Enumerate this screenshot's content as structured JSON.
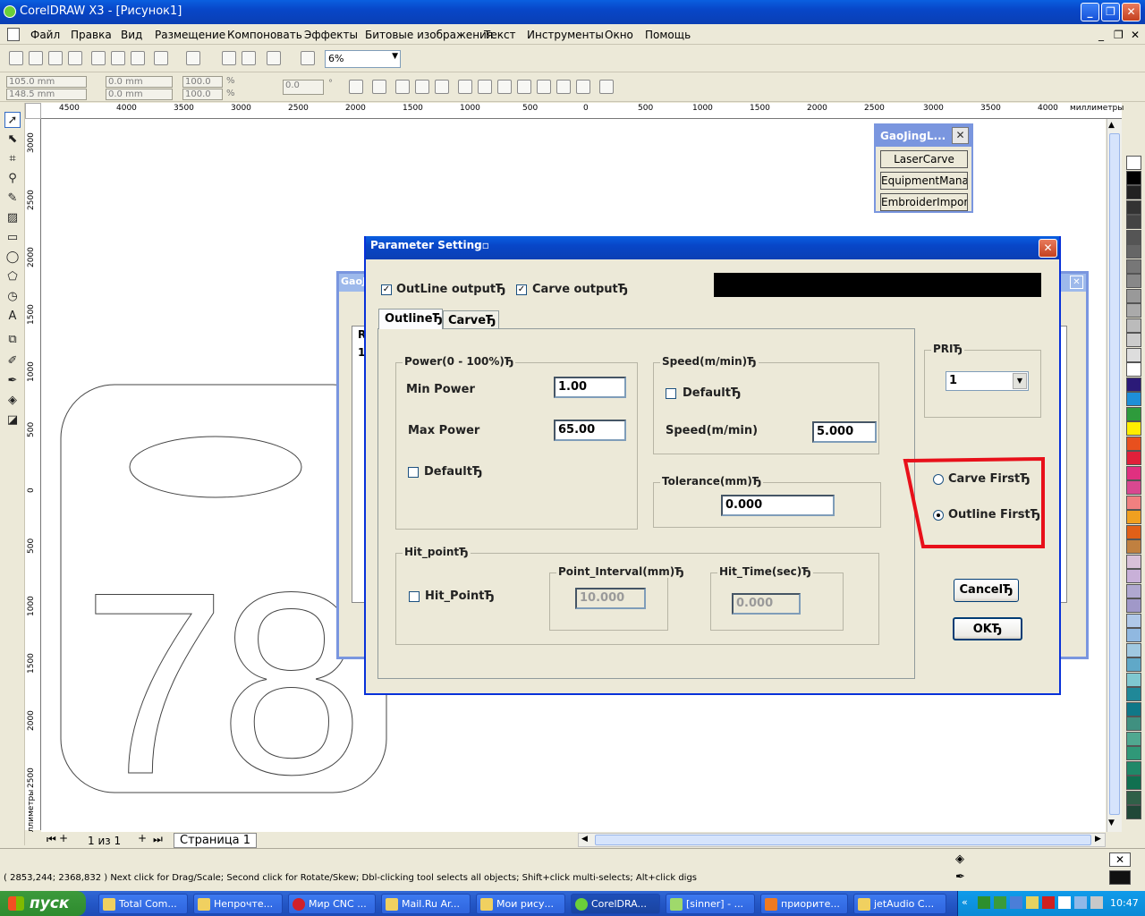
{
  "window": {
    "title": "CorelDRAW X3 - [Рисунок1]"
  },
  "menu": [
    "Файл",
    "Правка",
    "Вид",
    "Размещение",
    "Компоновать",
    "Эффекты",
    "Битовые изображения",
    "Текст",
    "Инструменты",
    "Окно",
    "Помощь"
  ],
  "toolbar": {
    "zoom": "6%"
  },
  "props": {
    "x": "105.0 mm",
    "y": "148.5 mm",
    "w": "0.0 mm",
    "h": "0.0 mm",
    "sx": "100.0",
    "sy": "100.0",
    "angle": "0.0",
    "pct": "%",
    "deg": "°"
  },
  "ruler_top": [
    "4500",
    "4000",
    "3500",
    "3000",
    "2500",
    "2000",
    "1500",
    "1000",
    "500",
    "0",
    "500",
    "1000",
    "1500",
    "2000",
    "2500",
    "3000",
    "3500",
    "4000",
    "миллиметры"
  ],
  "ruler_left": [
    "3000",
    "2500",
    "2000",
    "1500",
    "1000",
    "500",
    "0",
    "500",
    "1000",
    "1500",
    "2000",
    "2500",
    "миллиметры"
  ],
  "canvas": {
    "text": "78"
  },
  "gaojing": {
    "title": "GaoJingL...",
    "buttons": [
      "LaserCarve",
      "EquipmentManag",
      "EmbroiderImport"
    ]
  },
  "bg_window": {
    "title": "GaoJ",
    "col": "R",
    "row": "1"
  },
  "dialog": {
    "title": "Parameter Setting▫",
    "outline_output": "OutLine outputЂ",
    "carve_output": "Carve outputЂ",
    "tabs": [
      "OutlineЂ",
      "CarveЂ"
    ],
    "power": {
      "legend": "Power(0 - 100%)Ђ",
      "min_label": "Min Power",
      "min_value": "1.00",
      "max_label": "Max Power",
      "max_value": "65.00",
      "default_label": "DefaultЂ"
    },
    "speed": {
      "legend": "Speed(m/min)Ђ",
      "default_label": "DefaultЂ",
      "speed_label": "Speed(m/min)",
      "speed_value": "5.000"
    },
    "tolerance": {
      "legend": "Tolerance(mm)Ђ",
      "value": "0.000"
    },
    "hit": {
      "legend": "Hit_pointЂ",
      "checkbox_label": "Hit_PointЂ",
      "interval_legend": "Point_Interval(mm)Ђ",
      "interval_value": "10.000",
      "time_legend": "Hit_Time(sec)Ђ",
      "time_value": "0.000"
    },
    "pri": {
      "legend": "PRIЂ",
      "value": "1"
    },
    "order": {
      "carve_first": "Carve FirstЂ",
      "outline_first": "Outline FirstЂ"
    },
    "cancel": "CancelЂ",
    "ok": "OKЂ"
  },
  "pagetabs": {
    "page_of": "1 из 1",
    "page_name": "Страница 1"
  },
  "status": {
    "text": "( 2853,244; 2368,832 ) Next click for Drag/Scale; Second click for Rotate/Skew; Dbl-clicking tool selects all objects; Shift+click multi-selects; Alt+click digs"
  },
  "taskbar": {
    "start": "пуск",
    "tasks": [
      "Total Com...",
      "Непрочте...",
      "Мир CNC ...",
      "Mail.Ru Ar...",
      "Мои рису...",
      "CorelDRA...",
      "[sinner] - ...",
      "приорите...",
      "jetAudio C..."
    ],
    "clock": "10:47"
  },
  "colors": {
    "accent": "#0a5fe0",
    "highlight": "#e8101a"
  }
}
